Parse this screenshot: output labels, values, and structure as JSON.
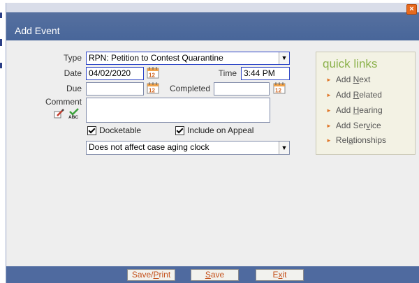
{
  "dialog": {
    "title": "Add Event",
    "close_symbol": "×"
  },
  "form": {
    "type_label": "Type",
    "type_value": "RPN: Petition to Contest Quarantine",
    "date_label": "Date",
    "date_value": "04/02/2020",
    "time_label": "Time",
    "time_value": "3:44 PM",
    "due_label": "Due",
    "due_value": "",
    "completed_label": "Completed",
    "completed_value": "",
    "comment_label": "Comment",
    "comment_value": "",
    "docketable_label": "Docketable",
    "docketable_checked": true,
    "include_appeal_label": "Include on Appeal",
    "include_appeal_checked": true,
    "aging_value": "Does not affect case aging clock",
    "dropdown_arrow": "▼"
  },
  "quick_links": {
    "title": "quick links",
    "items": [
      {
        "label_pre": "Add ",
        "label_key": "N",
        "label_post": "ext"
      },
      {
        "label_pre": "Add ",
        "label_key": "R",
        "label_post": "elated"
      },
      {
        "label_pre": "Add ",
        "label_key": "H",
        "label_post": "earing"
      },
      {
        "label_pre": "Add Ser",
        "label_key": "v",
        "label_post": "ice"
      },
      {
        "label_pre": "Rel",
        "label_key": "a",
        "label_post": "tionships"
      }
    ],
    "bullet": "►"
  },
  "buttons": {
    "save_print_pre": "Save/",
    "save_print_key": "P",
    "save_print_post": "rint",
    "save_key": "S",
    "save_post": "ave",
    "exit_pre": "E",
    "exit_key": "x",
    "exit_post": "it"
  },
  "colors": {
    "titlebar": "#48669a",
    "bottombar": "#4f6a9f",
    "accent_green": "#8bb14b",
    "link_orange": "#c4511b"
  }
}
